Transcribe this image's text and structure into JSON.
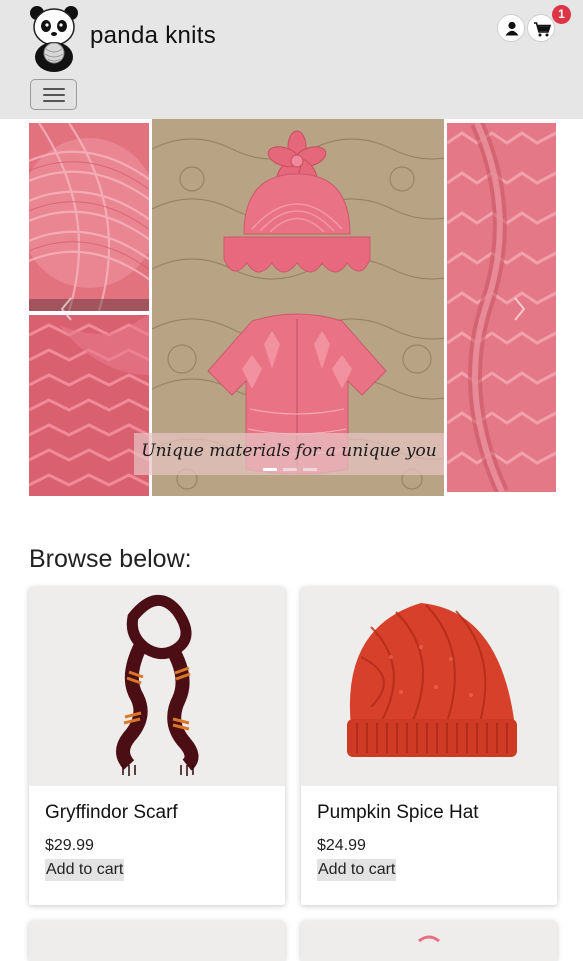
{
  "header": {
    "brand": "panda knits",
    "cart_count": "1",
    "logo_icon": "panda-with-yarn-logo",
    "account_icon": "user-icon",
    "cart_icon": "cart-icon",
    "menu_icon": "hamburger-icon"
  },
  "carousel": {
    "caption": "Unique materials for a unique you",
    "slide_count": 3,
    "active_slide": 1
  },
  "browse": {
    "title": "Browse below:"
  },
  "products": [
    {
      "name": "Gryffindor Scarf",
      "price": "$29.99",
      "button": "Add to cart"
    },
    {
      "name": "Pumpkin Spice Hat",
      "price": "$24.99",
      "button": "Add to cart"
    }
  ],
  "colors": {
    "navbar": "#e6e6e6",
    "yarn_pink": "#e86f82",
    "badge": "#dc3545"
  }
}
